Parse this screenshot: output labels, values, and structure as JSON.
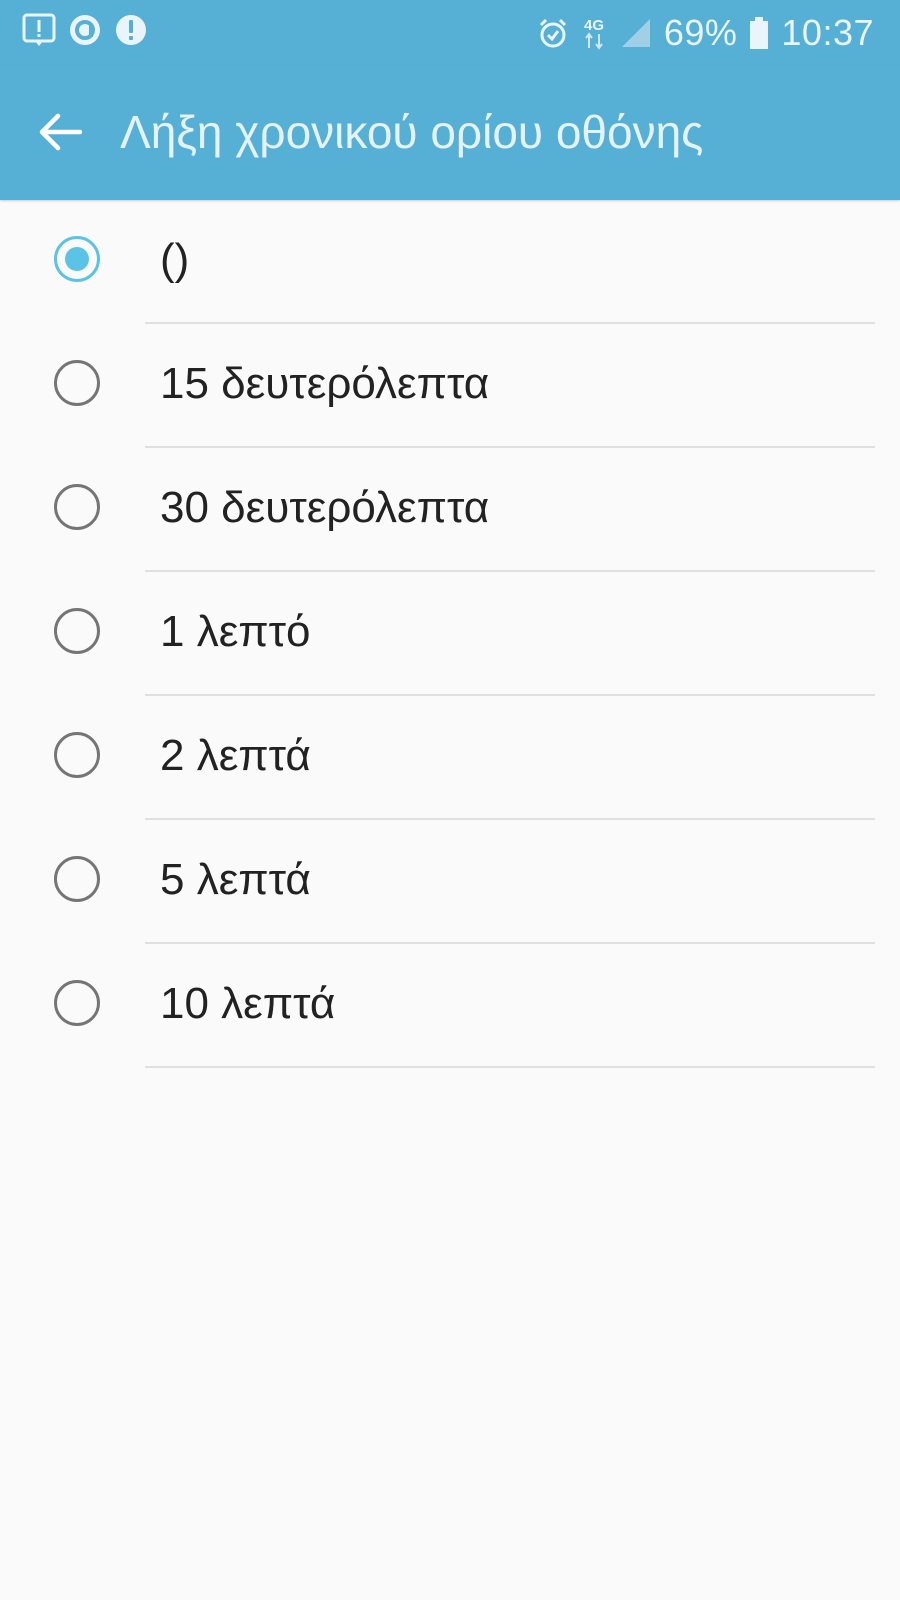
{
  "colors": {
    "accent": "#5bc3e6",
    "app_bar": "#56b0d6",
    "background": "#fafafa",
    "text_primary": "#222222",
    "radio_unchecked": "#757575",
    "divider": "#e0e0e0"
  },
  "status_bar": {
    "left_icons": [
      "notification-alert-icon",
      "app-notification-icon",
      "exclamation-icon"
    ],
    "right_icons": [
      "alarm-icon",
      "network-4g-icon",
      "signal-icon",
      "battery-icon"
    ],
    "network_label": "4G",
    "battery_percent": "69%",
    "time": "10:37"
  },
  "app_bar": {
    "back_icon": "arrow-back-icon",
    "title": "Λήξη χρονικού ορίου οθόνης"
  },
  "options": [
    {
      "label": "()",
      "selected": true
    },
    {
      "label": "15 δευτερόλεπτα",
      "selected": false
    },
    {
      "label": "30 δευτερόλεπτα",
      "selected": false
    },
    {
      "label": "1 λεπτό",
      "selected": false
    },
    {
      "label": "2 λεπτά",
      "selected": false
    },
    {
      "label": "5 λεπτά",
      "selected": false
    },
    {
      "label": "10 λεπτά",
      "selected": false
    }
  ]
}
